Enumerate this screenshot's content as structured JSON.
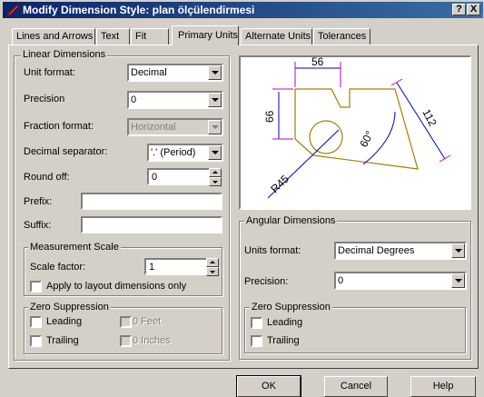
{
  "title": "Modify Dimension Style: plan ölçülendirmesi",
  "title_buttons": {
    "help": "?",
    "close": "X"
  },
  "tabs": [
    "Lines and Arrows",
    "Text",
    "Fit",
    "Primary Units",
    "Alternate Units",
    "Tolerances"
  ],
  "active_tab": "Primary Units",
  "linear": {
    "title": "Linear Dimensions",
    "unit_format_label": "Unit format:",
    "unit_format_value": "Decimal",
    "precision_label": "Precision",
    "precision_value": "0",
    "fraction_label": "Fraction format:",
    "fraction_value": "Horizontal",
    "decimal_sep_label": "Decimal separator:",
    "decimal_sep_value": "'.' (Period)",
    "round_off_label": "Round off:",
    "round_off_value": "0",
    "prefix_label": "Prefix:",
    "prefix_value": "",
    "suffix_label": "Suffix:",
    "suffix_value": ""
  },
  "measurement": {
    "title": "Measurement Scale",
    "scale_label": "Scale factor:",
    "scale_value": "1",
    "apply_layout": "Apply to layout dimensions only"
  },
  "zero_linear": {
    "title": "Zero Suppression",
    "leading": "Leading",
    "trailing": "Trailing",
    "zero_feet": "0 Feet",
    "zero_inches": "0 Inches"
  },
  "preview": {
    "dim_top": "56",
    "dim_left": "66",
    "dim_right": "112",
    "dim_angle": "60°",
    "dim_radius": "R45"
  },
  "angular": {
    "title": "Angular Dimensions",
    "units_format_label": "Units format:",
    "units_format_value": "Decimal Degrees",
    "precision_label": "Precision:",
    "precision_value": "0"
  },
  "zero_angular": {
    "title": "Zero Suppression",
    "leading": "Leading",
    "trailing": "Trailing"
  },
  "buttons": {
    "ok": "OK",
    "cancel": "Cancel",
    "help": "Help"
  }
}
